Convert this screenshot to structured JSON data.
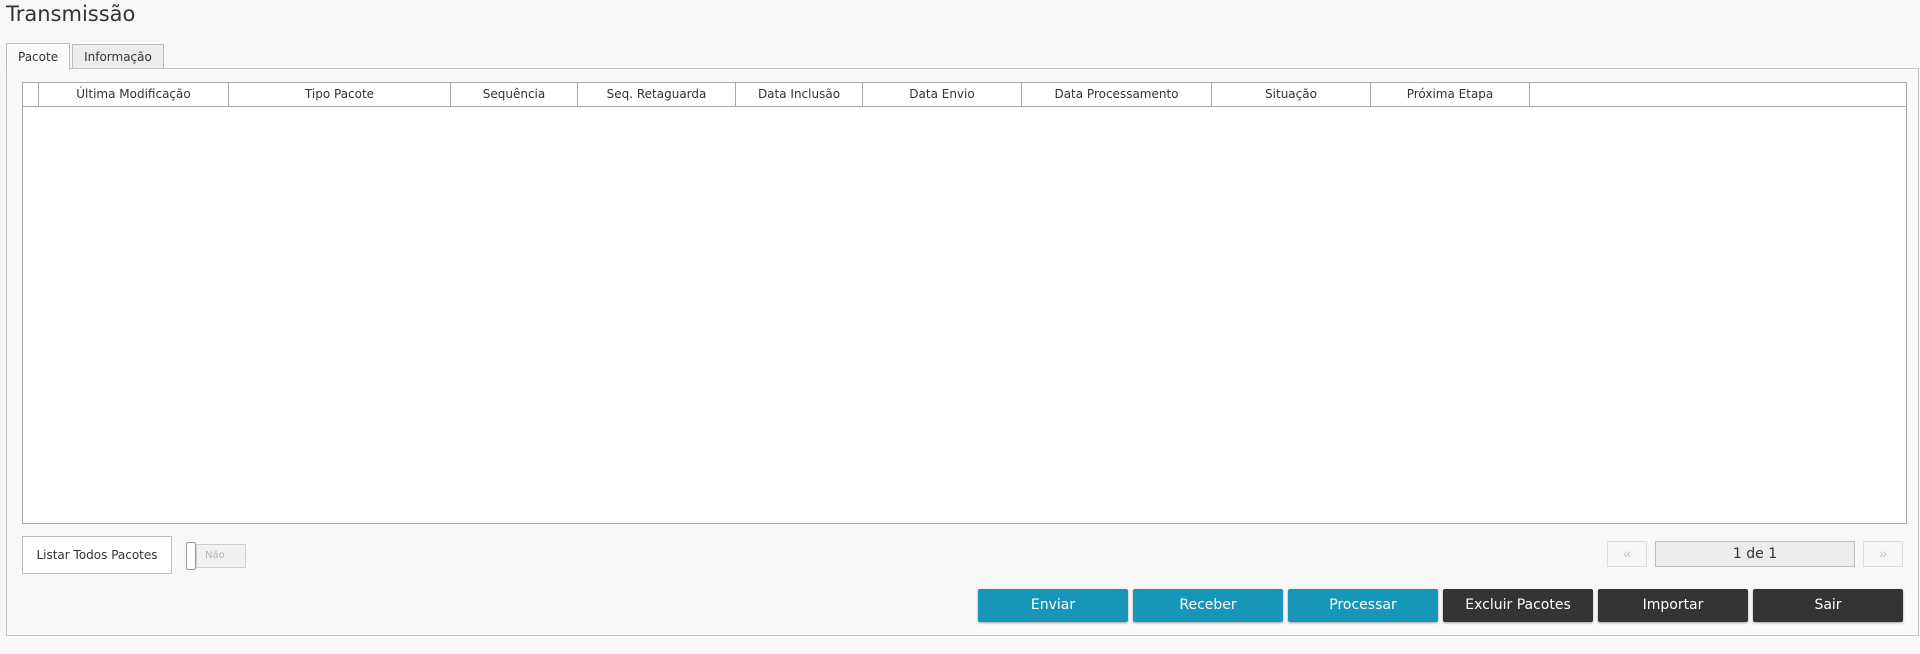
{
  "page": {
    "title": "Transmissão"
  },
  "tabs": [
    {
      "label": "Pacote",
      "active": true
    },
    {
      "label": "Informação",
      "active": false
    }
  ],
  "grid": {
    "columns": [
      "",
      "Última Modificação",
      "Tipo Pacote",
      "Sequência",
      "Seq. Retaguarda",
      "Data Inclusão",
      "Data Envio",
      "Data Processamento",
      "Situação",
      "Próxima Etapa",
      ""
    ],
    "rows": []
  },
  "filters": {
    "list_all_label": "Listar Todos Pacotes",
    "toggle_value": "Não"
  },
  "pager": {
    "prev_icon": "«",
    "next_icon": "»",
    "display": "1 de 1"
  },
  "actions": {
    "enviar": "Enviar",
    "receber": "Receber",
    "processar": "Processar",
    "excluir": "Excluir Pacotes",
    "importar": "Importar",
    "sair": "Sair"
  },
  "colors": {
    "primary_button": "#1796b9",
    "dark_button": "#333436",
    "background": "#f7f7f7"
  }
}
